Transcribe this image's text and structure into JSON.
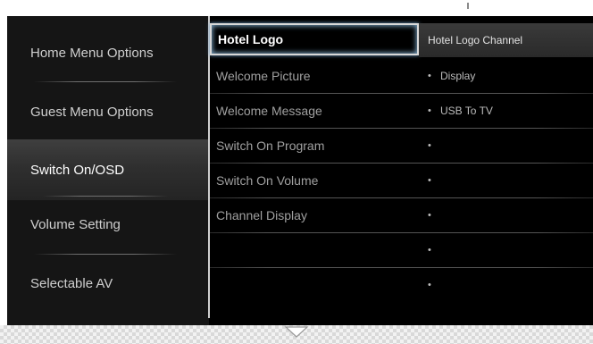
{
  "left_menu": [
    {
      "label": "Home Menu Options"
    },
    {
      "label": "Guest Menu Options"
    },
    {
      "label": "Switch On/OSD"
    },
    {
      "label": "Volume Setting"
    },
    {
      "label": "Selectable AV"
    }
  ],
  "left_selected_index": 2,
  "middle_menu": [
    {
      "label": "Hotel Logo"
    },
    {
      "label": "Welcome Picture"
    },
    {
      "label": "Welcome Message"
    },
    {
      "label": "Switch On Program"
    },
    {
      "label": "Switch On Volume"
    },
    {
      "label": "Channel Display"
    },
    {
      "label": ""
    },
    {
      "label": ""
    }
  ],
  "middle_selected_index": 0,
  "right_menu": [
    {
      "label": "Hotel Logo Channel",
      "bullet": ""
    },
    {
      "label": "Display",
      "bullet": "•"
    },
    {
      "label": "USB To TV",
      "bullet": "•"
    },
    {
      "label": "",
      "bullet": "•"
    },
    {
      "label": "",
      "bullet": "•"
    },
    {
      "label": "",
      "bullet": "•"
    },
    {
      "label": "",
      "bullet": "•"
    },
    {
      "label": "",
      "bullet": "•"
    }
  ],
  "icons": {
    "scroll_down": "chevron-down-icon"
  },
  "colors": {
    "background": "#000000",
    "selected_border": "#d8d8d8",
    "selected_glow": "#7aa4c4"
  }
}
